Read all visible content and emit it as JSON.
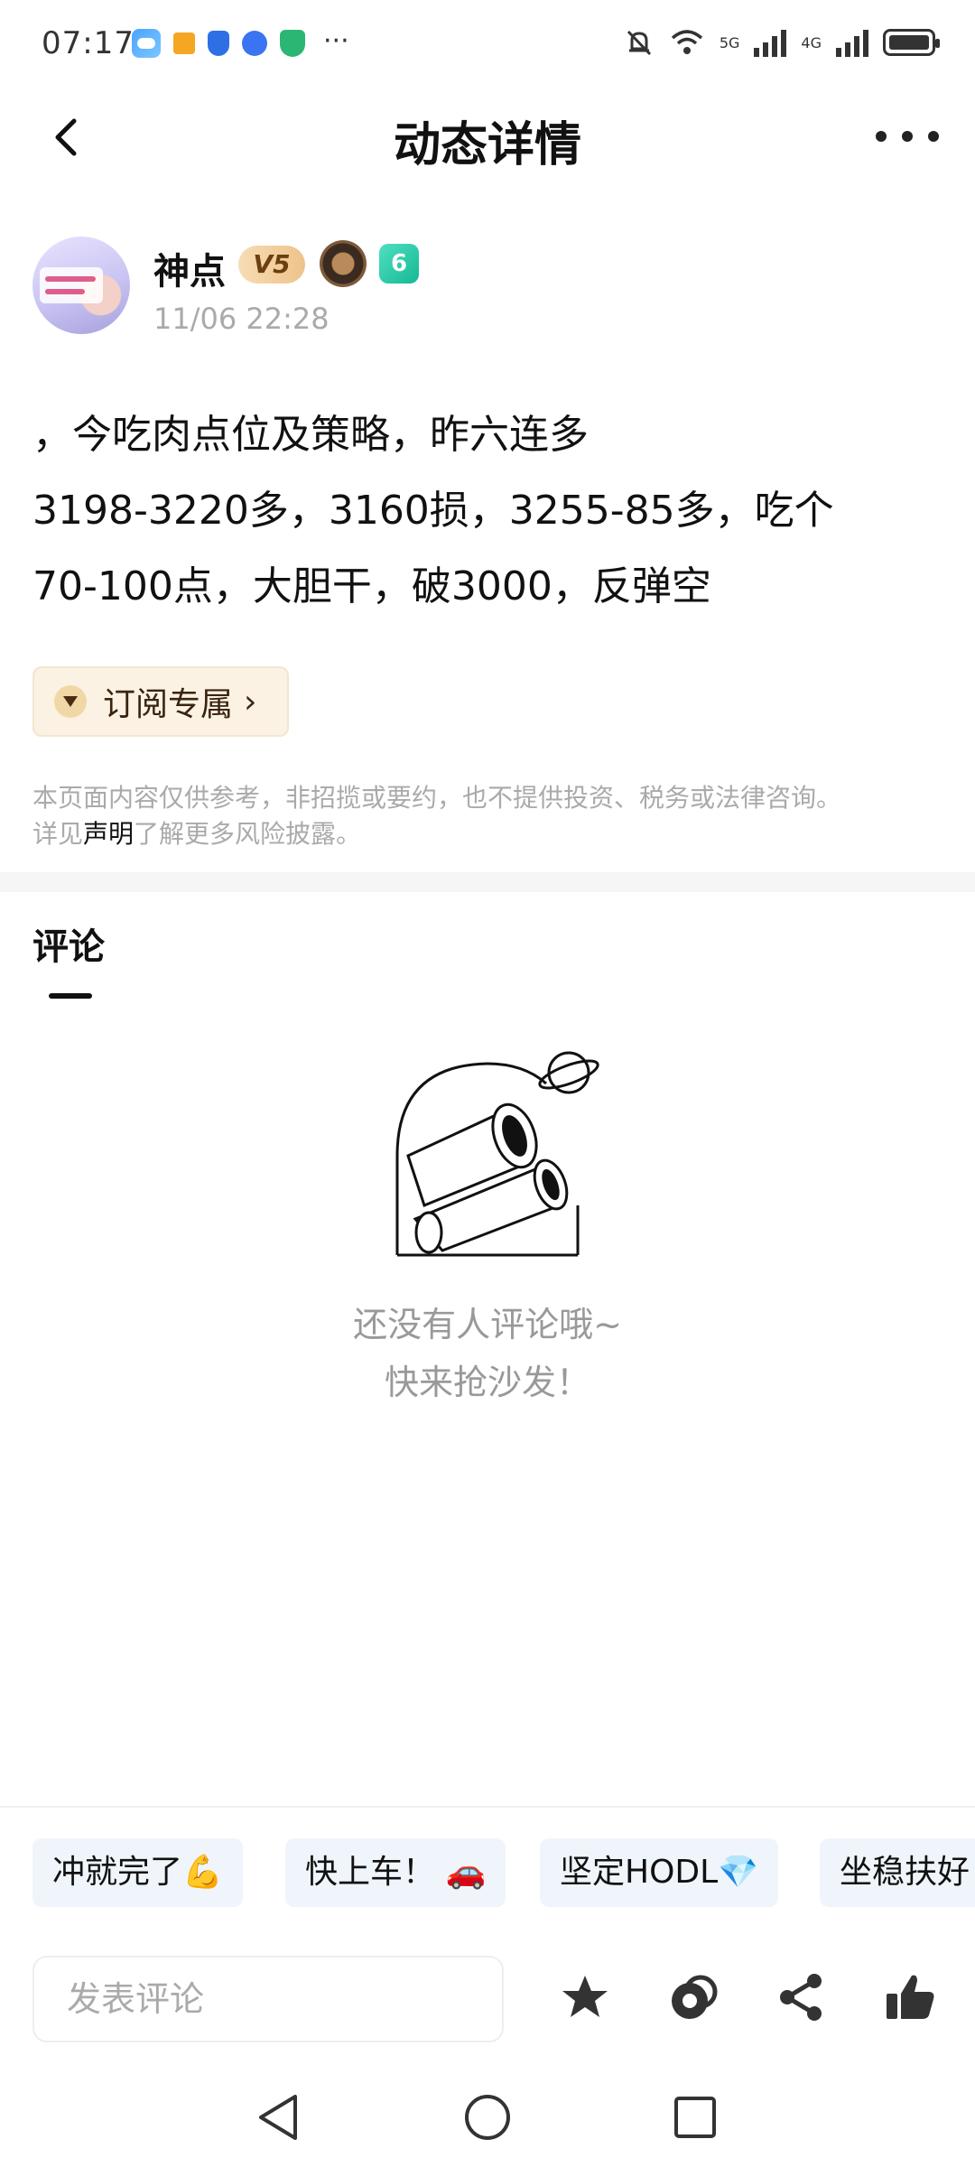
{
  "status_bar": {
    "time": "07:17",
    "more": "···",
    "net1": "5G",
    "net2": "4G"
  },
  "header": {
    "title": "动态详情"
  },
  "author": {
    "name": "神点",
    "vip_badge": "V5",
    "level_badge": "6",
    "post_time": "11/06 22:28"
  },
  "post": {
    "lines": [
      "，今吃肉点位及策略，昨六连多",
      "3198-3220多，3160损，3255-85多，吃个",
      "70-100点，大胆干，破3000，反弹空"
    ],
    "subscription_label": "订阅专属"
  },
  "disclaimer": {
    "line1": "本页面内容仅供参考，非招揽或要约，也不提供投资、税务或法律咨询。",
    "prefix": "详见",
    "link": "声明",
    "suffix": "了解更多风险披露。"
  },
  "comments": {
    "title": "评论",
    "empty_line1": "还没有人评论哦~",
    "empty_line2": "快来抢沙发！"
  },
  "quick_replies": [
    "冲就完了💪",
    "快上车！ 🚗",
    "坚定HODL💎",
    "坐稳扶好"
  ],
  "input": {
    "placeholder": "发表评论"
  },
  "icons": {
    "back": "back-arrow-icon",
    "more": "more-dots-icon",
    "favorite": "star-icon",
    "coin": "coin-icon",
    "share": "share-icon",
    "like": "thumbs-up-icon"
  },
  "colors": {
    "accent_gold": "#eec38a",
    "level_green": "#17b894",
    "chip_bg": "#f0f5fb",
    "muted_text": "#aaaaaa"
  }
}
